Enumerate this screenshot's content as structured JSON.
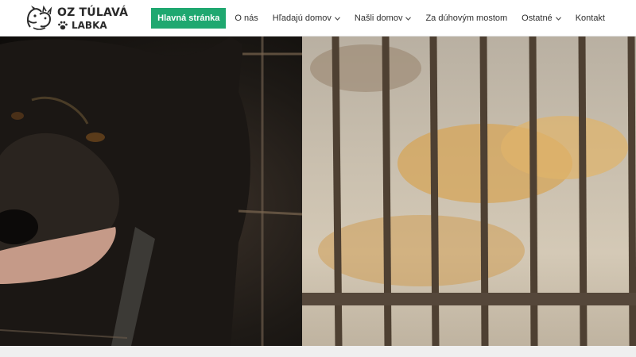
{
  "brand": {
    "line1": "OZ TÚLAVÁ",
    "line2": "LABKA"
  },
  "nav": {
    "items": [
      {
        "label": "Hlavná stránka",
        "active": true,
        "dropdown": false
      },
      {
        "label": "O nás",
        "active": false,
        "dropdown": false
      },
      {
        "label": "Hľadajú domov",
        "active": false,
        "dropdown": true
      },
      {
        "label": "Našli domov",
        "active": false,
        "dropdown": true
      },
      {
        "label": "Za dúhovým mostom",
        "active": false,
        "dropdown": false
      },
      {
        "label": "Ostatné",
        "active": false,
        "dropdown": true
      },
      {
        "label": "Kontakt",
        "active": false,
        "dropdown": false
      }
    ]
  },
  "colors": {
    "accent": "#1fa870",
    "header_bg": "#ffffff",
    "text": "#2f2f2f"
  },
  "hero": {
    "image": "photo-black-dog-behind-cage-bars"
  },
  "icons": {
    "logo": "dog-and-cat-logo-icon",
    "paw": "paw-icon",
    "chevron": "chevron-down-icon"
  }
}
